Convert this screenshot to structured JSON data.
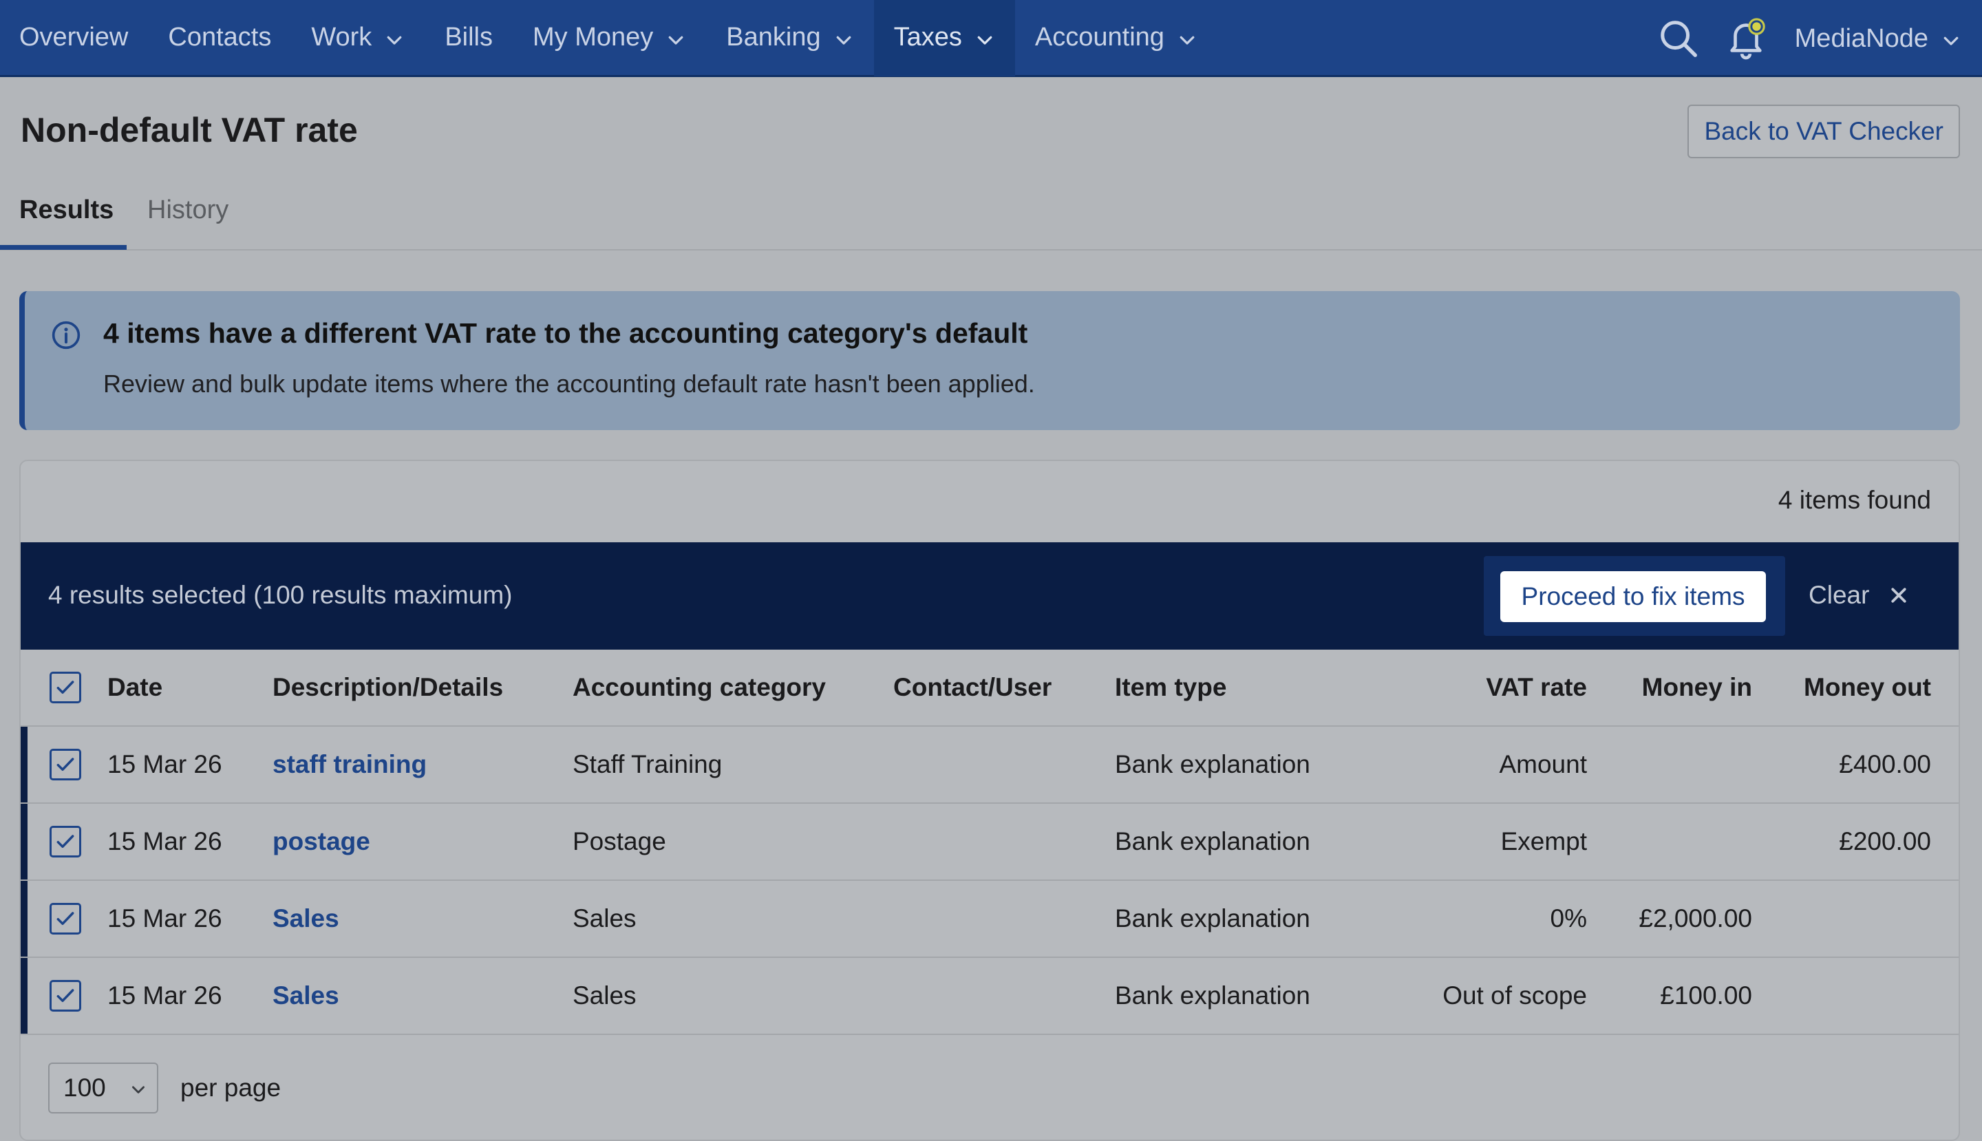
{
  "nav": {
    "items": [
      {
        "label": "Overview",
        "dropdown": false,
        "active": false
      },
      {
        "label": "Contacts",
        "dropdown": false,
        "active": false
      },
      {
        "label": "Work",
        "dropdown": true,
        "active": false
      },
      {
        "label": "Bills",
        "dropdown": false,
        "active": false
      },
      {
        "label": "My Money",
        "dropdown": true,
        "active": false
      },
      {
        "label": "Banking",
        "dropdown": true,
        "active": false
      },
      {
        "label": "Taxes",
        "dropdown": true,
        "active": true
      },
      {
        "label": "Accounting",
        "dropdown": true,
        "active": false
      }
    ],
    "user": "MediaNode",
    "search_icon": "search-icon",
    "notification_icon": "bell-icon"
  },
  "page": {
    "title": "Non-default VAT rate",
    "back_button": "Back to VAT Checker",
    "tabs": [
      "Results",
      "History"
    ]
  },
  "alert": {
    "icon": "info-icon",
    "title": "4 items have a different VAT rate to the accounting category's default",
    "body": "Review and bulk update items where the accounting default rate hasn't been applied."
  },
  "results": {
    "items_found": "4 items found",
    "selection_text": "4 results selected (100 results maximum)",
    "proceed_button": "Proceed to fix items",
    "clear_button": "Clear",
    "columns": {
      "date": "Date",
      "description": "Description/Details",
      "category": "Accounting category",
      "contact": "Contact/User",
      "item_type": "Item type",
      "vat_rate": "VAT rate",
      "money_in": "Money in",
      "money_out": "Money out"
    },
    "rows": [
      {
        "date": "15 Mar 26",
        "description": "staff training",
        "category": "Staff Training",
        "contact": "",
        "item_type": "Bank explanation",
        "vat_rate": "Amount",
        "money_in": "",
        "money_out": "£400.00"
      },
      {
        "date": "15 Mar 26",
        "description": "postage",
        "category": "Postage",
        "contact": "",
        "item_type": "Bank explanation",
        "vat_rate": "Exempt",
        "money_in": "",
        "money_out": "£200.00"
      },
      {
        "date": "15 Mar 26",
        "description": "Sales",
        "category": "Sales",
        "contact": "",
        "item_type": "Bank explanation",
        "vat_rate": "0%",
        "money_in": "£2,000.00",
        "money_out": ""
      },
      {
        "date": "15 Mar 26",
        "description": "Sales",
        "category": "Sales",
        "contact": "",
        "item_type": "Bank explanation",
        "vat_rate": "Out of scope",
        "money_in": "£100.00",
        "money_out": ""
      }
    ],
    "per_page_value": "100",
    "per_page_label": "per page"
  },
  "colors": {
    "nav_bg": "#1d4488",
    "selection_bar": "#0a1d44",
    "link": "#1d4488"
  }
}
